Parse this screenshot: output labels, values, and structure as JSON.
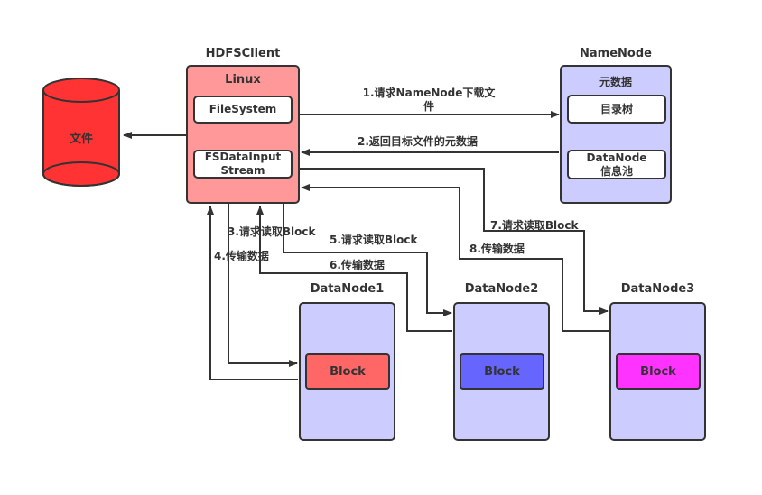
{
  "colors": {
    "file": "#ff3333",
    "client": "#ff9999",
    "node": "#ccccff",
    "block1": "#ff6666",
    "block2": "#6666ff",
    "block3": "#ff33ff",
    "line": "#333333"
  },
  "file": {
    "label": "文件"
  },
  "client": {
    "title": "HDFSClient",
    "os": "Linux",
    "filesystem": "FileSystem",
    "stream_line1": "FSDataInput",
    "stream_line2": "Stream"
  },
  "namenode": {
    "title": "NameNode",
    "subtitle": "元数据",
    "dir_tree": "目录树",
    "pool_line1": "DataNode",
    "pool_line2": "信息池"
  },
  "datanodes": [
    {
      "title": "DataNode1",
      "block": "Block"
    },
    {
      "title": "DataNode2",
      "block": "Block"
    },
    {
      "title": "DataNode3",
      "block": "Block"
    }
  ],
  "steps": {
    "s1_line1": "1.请求NameNode下载文",
    "s1_line2": "件",
    "s2": "2.返回目标文件的元数据",
    "s3": "3.请求读取Block",
    "s4": "4.传输数据",
    "s5": "5.请求读取Block",
    "s6": "6.传输数据",
    "s7": "7.请求读取Block",
    "s8": "8.传输数据"
  }
}
